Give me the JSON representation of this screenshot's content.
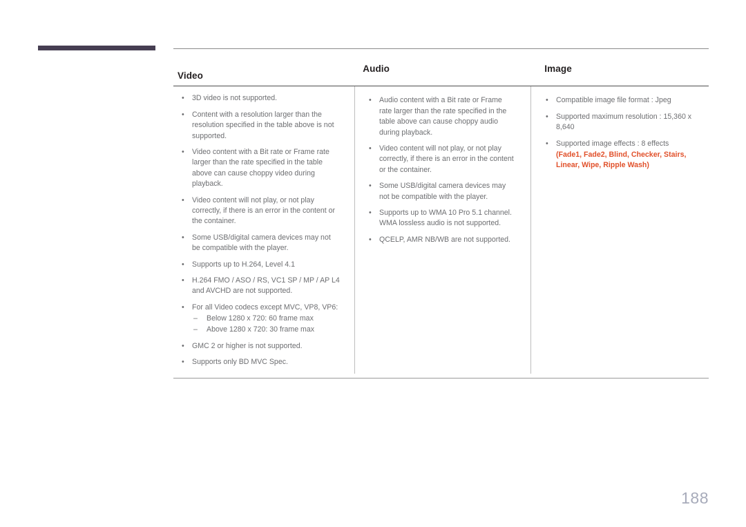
{
  "page": {
    "number": "188",
    "accent_color": "#e1512b",
    "chapter_bar_color": "#463e52",
    "page_number_color": "#a7abba"
  },
  "table": {
    "columns": [
      {
        "header": "Video",
        "items": [
          {
            "text": "3D video is not supported."
          },
          {
            "text": "Content with a resolution larger than the resolution specified in the table above is not supported."
          },
          {
            "text": "Video content with a Bit rate or Frame rate larger than the rate specified in the table above can cause choppy video during playback."
          },
          {
            "text": "Video content will not play, or not play correctly, if there is an error in the content or the container."
          },
          {
            "text": "Some USB/digital camera devices may not be compatible with the player."
          },
          {
            "text": "Supports up to H.264, Level 4.1"
          },
          {
            "text": "H.264 FMO / ASO / RS, VC1 SP / MP / AP L4 and AVCHD are not supported."
          },
          {
            "text": "For all Video codecs except MVC, VP8, VP6:",
            "sub": [
              "Below 1280 x 720: 60 frame max",
              "Above 1280 x 720: 30 frame max"
            ]
          },
          {
            "text": "GMC 2 or higher is not supported."
          },
          {
            "text": "Supports only BD MVC Spec."
          }
        ]
      },
      {
        "header": "Audio",
        "items": [
          {
            "text": "Audio content with a Bit rate or Frame rate larger than the rate specified in the table above can cause choppy audio during playback."
          },
          {
            "text": "Video content will not play, or not play correctly, if there is an error in the content or the container."
          },
          {
            "text": "Some USB/digital camera devices may not be compatible with the player."
          },
          {
            "text": "Supports up to WMA 10 Pro 5.1 channel. WMA lossless audio is not supported."
          },
          {
            "text": "QCELP, AMR NB/WB are not supported."
          }
        ]
      },
      {
        "header": "Image",
        "items": [
          {
            "text": "Compatible image file format : Jpeg"
          },
          {
            "text": "Supported maximum resolution : 15,360 x 8,640"
          },
          {
            "text": "Supported image effects : 8 effects",
            "accent": "(Fade1, Fade2, Blind, Checker, Stairs, Linear, Wipe, Ripple Wash)"
          }
        ]
      }
    ]
  },
  "symbols": {
    "bullet": "•",
    "dash": "–"
  }
}
